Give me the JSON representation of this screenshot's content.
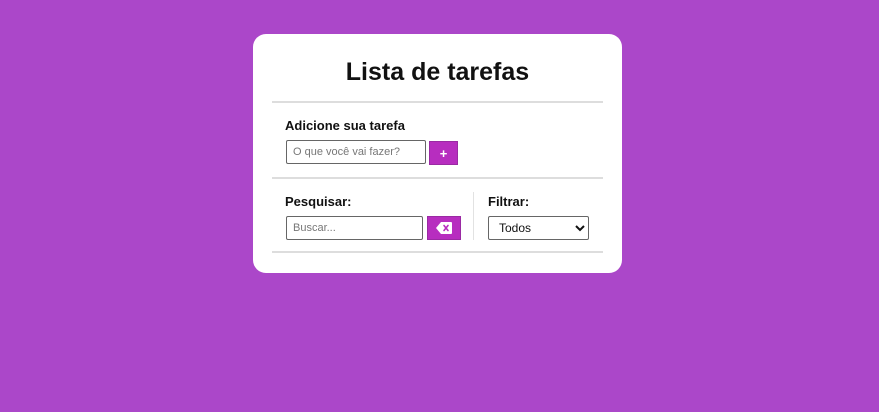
{
  "app": {
    "title": "Lista de tarefas"
  },
  "add_task": {
    "label": "Adicione sua tarefa",
    "placeholder": "O que você vai fazer?",
    "button_label": "+"
  },
  "search": {
    "label": "Pesquisar:",
    "placeholder": "Buscar...",
    "clear_icon": "backspace-icon"
  },
  "filter": {
    "label": "Filtrar:",
    "selected": "Todos",
    "options": [
      "Todos"
    ]
  },
  "colors": {
    "background": "#ab47c9",
    "accent": "#b72dbf",
    "card": "#ffffff"
  }
}
